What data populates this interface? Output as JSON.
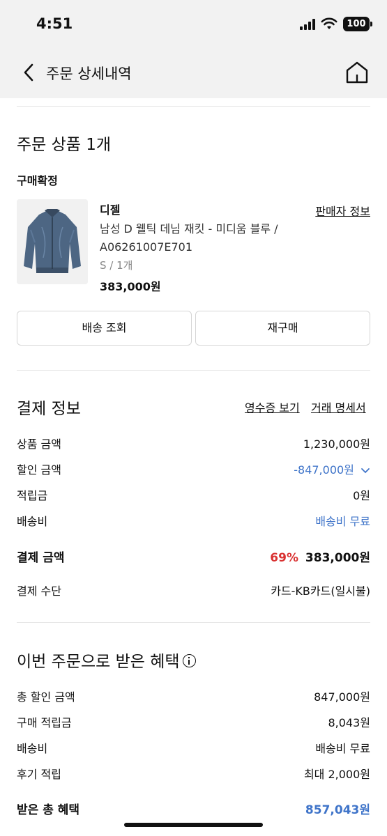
{
  "status_bar": {
    "time": "4:51",
    "battery": "100"
  },
  "header": {
    "title": "주문 상세내역",
    "back_icon": "chevron-left-icon",
    "home_icon": "home-icon"
  },
  "order_items": {
    "title": "주문 상품 1개",
    "status": "구매확정",
    "product": {
      "brand": "디젤",
      "seller_info_label": "판매자 정보",
      "name_line1": "남성 D 웰틱 데님 재킷 - 미디움 블루 /",
      "name_line2": "A06261007E701",
      "option": "S / 1개",
      "price": "383,000원",
      "image": "denim-jacket-image"
    },
    "buttons": {
      "track_delivery": "배송 조회",
      "reorder": "재구매"
    }
  },
  "payment": {
    "title": "결제 정보",
    "receipt_link": "영수증 보기",
    "statement_link": "거래 명세서",
    "rows": {
      "product_amount": {
        "label": "상품 금액",
        "value": "1,230,000원"
      },
      "discount_amount": {
        "label": "할인 금액",
        "value": "-847,000원"
      },
      "points": {
        "label": "적립금",
        "value": "0원"
      },
      "shipping": {
        "label": "배송비",
        "value": "배송비 무료"
      }
    },
    "total": {
      "label": "결제 금액",
      "percent": "69%",
      "value": "383,000원"
    },
    "method": {
      "label": "결제 수단",
      "value": "카드-KB카드(일시불)"
    }
  },
  "benefits": {
    "title": "이번 주문으로 받은 혜택",
    "rows": {
      "total_discount": {
        "label": "총 할인 금액",
        "value": "847,000원"
      },
      "purchase_points": {
        "label": "구매 적립금",
        "value": "8,043원"
      },
      "shipping": {
        "label": "배송비",
        "value": "배송비 무료"
      },
      "review_points": {
        "label": "후기 적립",
        "value": "최대 2,000원"
      }
    },
    "total": {
      "label": "받은 총 혜택",
      "value": "857,043원"
    }
  },
  "colors": {
    "accent_blue": "#3f74c9",
    "discount_red": "#d93232",
    "header_bg": "#f2f2f2"
  }
}
